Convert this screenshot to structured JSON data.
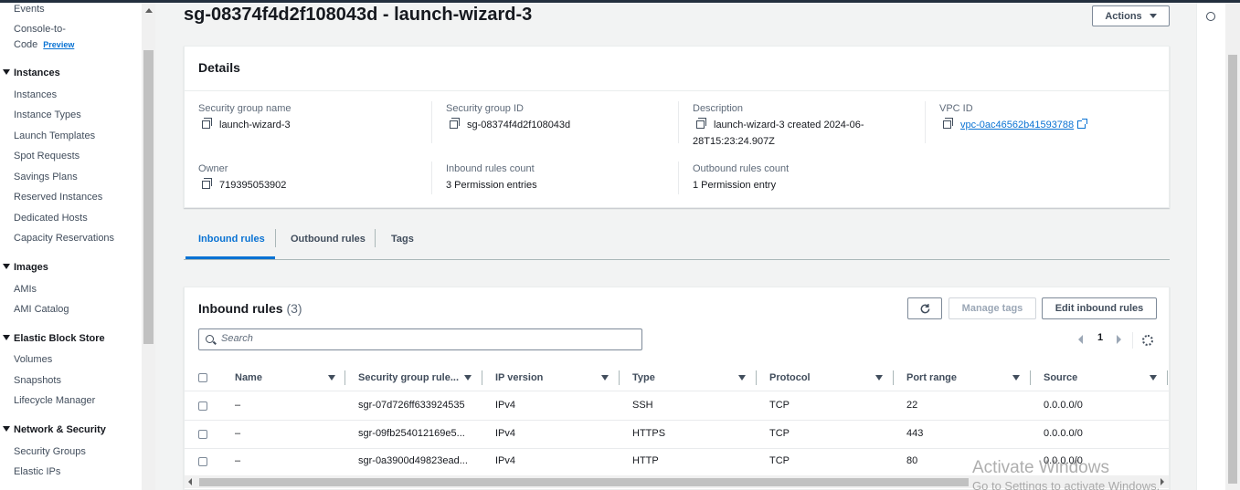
{
  "sidebar": {
    "items": [
      {
        "label": "Events",
        "type": "item"
      },
      {
        "label": "Console-to-",
        "type": "item"
      },
      {
        "label": "Code",
        "type": "item",
        "badge": "Preview"
      },
      {
        "label": "Instances",
        "type": "section"
      },
      {
        "label": "Instances",
        "type": "item"
      },
      {
        "label": "Instance Types",
        "type": "item"
      },
      {
        "label": "Launch Templates",
        "type": "item"
      },
      {
        "label": "Spot Requests",
        "type": "item"
      },
      {
        "label": "Savings Plans",
        "type": "item"
      },
      {
        "label": "Reserved Instances",
        "type": "item"
      },
      {
        "label": "Dedicated Hosts",
        "type": "item"
      },
      {
        "label": "Capacity Reservations",
        "type": "item"
      },
      {
        "label": "Images",
        "type": "section"
      },
      {
        "label": "AMIs",
        "type": "item"
      },
      {
        "label": "AMI Catalog",
        "type": "item"
      },
      {
        "label": "Elastic Block Store",
        "type": "section"
      },
      {
        "label": "Volumes",
        "type": "item"
      },
      {
        "label": "Snapshots",
        "type": "item"
      },
      {
        "label": "Lifecycle Manager",
        "type": "item"
      },
      {
        "label": "Network & Security",
        "type": "section"
      },
      {
        "label": "Security Groups",
        "type": "item"
      },
      {
        "label": "Elastic IPs",
        "type": "item"
      }
    ]
  },
  "header": {
    "title": "sg-08374f4d2f108043d - launch-wizard-3",
    "actions_label": "Actions"
  },
  "details": {
    "title": "Details",
    "fields": {
      "sg_name_label": "Security group name",
      "sg_name_value": "launch-wizard-3",
      "sg_id_label": "Security group ID",
      "sg_id_value": "sg-08374f4d2f108043d",
      "description_label": "Description",
      "description_line1": "launch-wizard-3 created 2024-06-",
      "description_line2": "28T15:23:24.907Z",
      "vpc_label": "VPC ID",
      "vpc_value": "vpc-0ac46562b41593788",
      "owner_label": "Owner",
      "owner_value": "719395053902",
      "inbound_count_label": "Inbound rules count",
      "inbound_count_value": "3 Permission entries",
      "outbound_count_label": "Outbound rules count",
      "outbound_count_value": "1 Permission entry"
    }
  },
  "tabs": [
    {
      "label": "Inbound rules",
      "active": true
    },
    {
      "label": "Outbound rules",
      "active": false
    },
    {
      "label": "Tags",
      "active": false
    }
  ],
  "inbound": {
    "title": "Inbound rules",
    "count": "(3)",
    "manage_tags_label": "Manage tags",
    "edit_label": "Edit inbound rules",
    "search_placeholder": "Search",
    "page_number": "1",
    "columns": [
      "Name",
      "Security group rule...",
      "IP version",
      "Type",
      "Protocol",
      "Port range",
      "Source"
    ],
    "rows": [
      {
        "name": "–",
        "rule_id": "sgr-07d726ff633924535",
        "ip_version": "IPv4",
        "type": "SSH",
        "protocol": "TCP",
        "port_range": "22",
        "source": "0.0.0.0/0"
      },
      {
        "name": "–",
        "rule_id": "sgr-09fb254012169e5...",
        "ip_version": "IPv4",
        "type": "HTTPS",
        "protocol": "TCP",
        "port_range": "443",
        "source": "0.0.0.0/0"
      },
      {
        "name": "–",
        "rule_id": "sgr-0a3900d49823ead...",
        "ip_version": "IPv4",
        "type": "HTTP",
        "protocol": "TCP",
        "port_range": "80",
        "source": "0.0.0.0/0"
      }
    ]
  },
  "watermark": {
    "line1": "Activate Windows",
    "line2": "Go to Settings to activate Windows."
  },
  "colors": {
    "link": "#0972d3",
    "text": "#16191f",
    "secondary": "#5f6b7a"
  }
}
